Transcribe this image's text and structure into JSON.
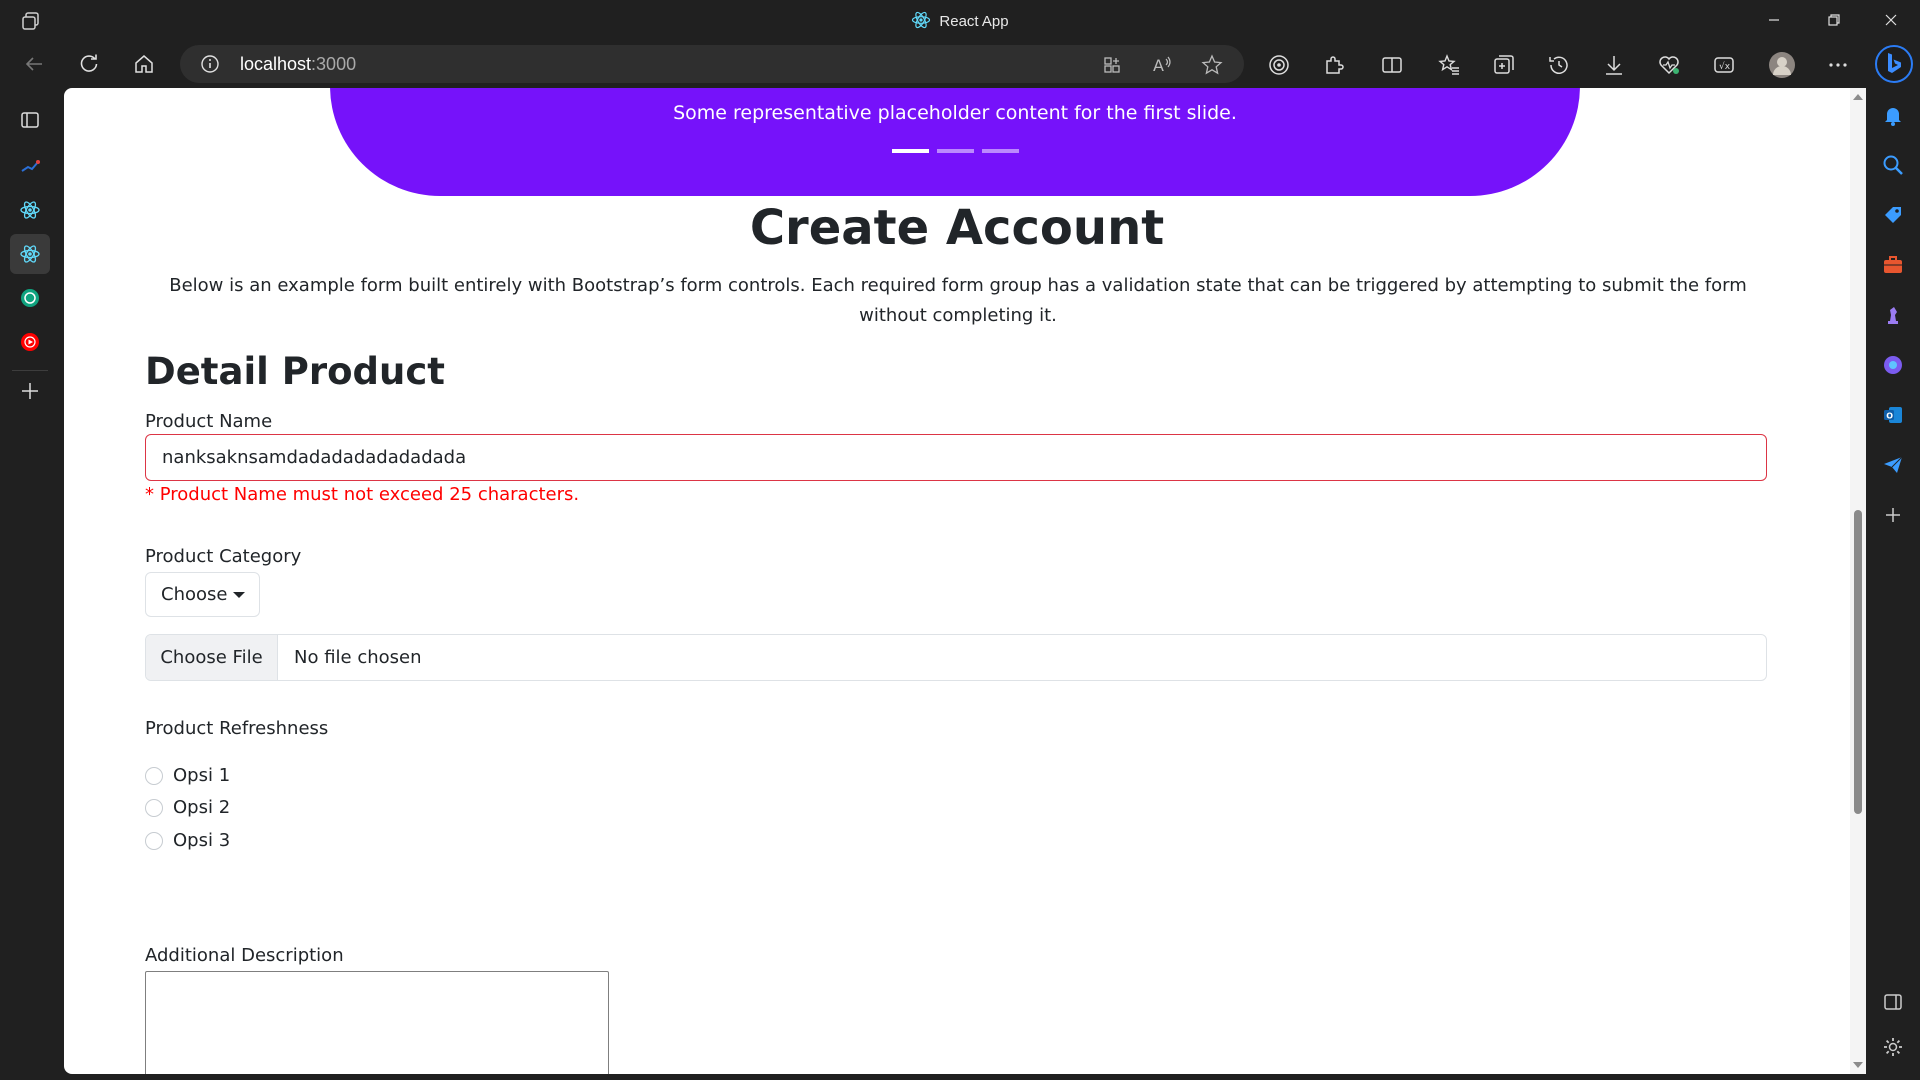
{
  "browser": {
    "window_title": "React App",
    "url_host": "localhost",
    "url_port": ":3000"
  },
  "page": {
    "carousel_caption": "Some representative placeholder content for the first slide.",
    "carousel_active_index": 0,
    "heading": "Create Account",
    "lead": "Below is an example form built entirely with Bootstrap’s form controls. Each required form group has a validation state that can be triggered by attempting to submit the form without completing it.",
    "section_title": "Detail Product",
    "product_name": {
      "label": "Product Name",
      "value": "nanksaknsamdadadadadadadada",
      "error": "* Product Name must not exceed 25 characters."
    },
    "product_category": {
      "label": "Product Category",
      "selected": "Choose"
    },
    "file": {
      "button_label": "Choose File",
      "status": "No file chosen"
    },
    "freshness": {
      "label": "Product Refreshness",
      "options": [
        "Opsi 1",
        "Opsi 2",
        "Opsi 3"
      ]
    },
    "description": {
      "label": "Additional Description",
      "value": ""
    }
  },
  "colors": {
    "carousel": "#7612fa",
    "error": "#ff0000",
    "invalid_border": "#dc3545"
  }
}
